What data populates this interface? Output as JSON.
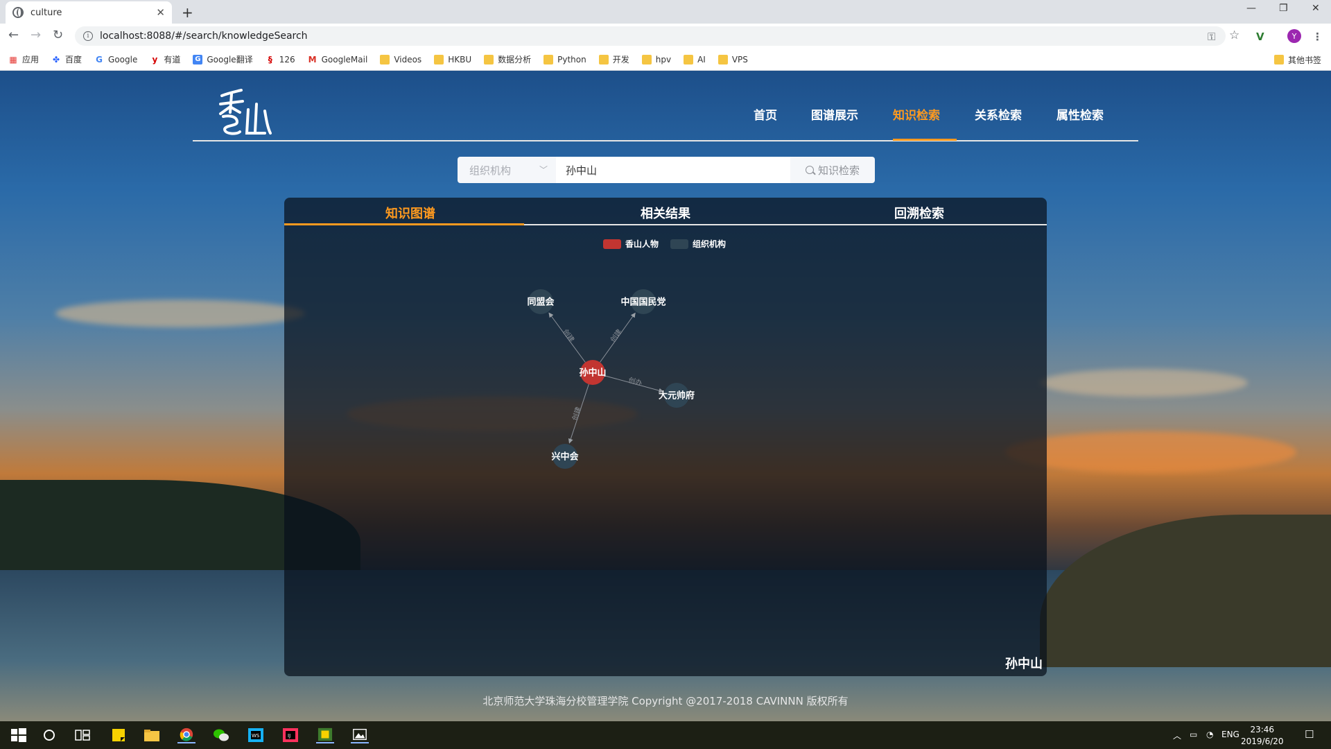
{
  "browser": {
    "tab_title": "culture",
    "url": "localhost:8088/#/search/knowledgeSearch",
    "bookmarks": [
      "应用",
      "百度",
      "Google",
      "有道",
      "Google翻译",
      "126",
      "GoogleMail",
      "Videos",
      "HKBU",
      "数据分析",
      "Python",
      "开发",
      "hpv",
      "AI",
      "VPS"
    ],
    "other_bookmarks": "其他书签",
    "avatar_letter": "Y"
  },
  "site": {
    "nav": [
      "首页",
      "图谱展示",
      "知识检索",
      "关系检索",
      "属性检索"
    ],
    "active_nav": "知识检索"
  },
  "search": {
    "category": "组织机构",
    "query": "孙中山",
    "button": "知识检索"
  },
  "panel": {
    "tabs": [
      "知识图谱",
      "相关结果",
      "回溯检索"
    ],
    "active_tab": "知识图谱",
    "legend": [
      {
        "label": "香山人物",
        "color": "#c23531"
      },
      {
        "label": "组织机构",
        "color": "#2f4554"
      }
    ],
    "corner_name": "孙中山"
  },
  "graph": {
    "nodes": [
      {
        "id": "孙中山",
        "category": "香山人物"
      },
      {
        "id": "同盟会",
        "category": "组织机构"
      },
      {
        "id": "中国国民党",
        "category": "组织机构"
      },
      {
        "id": "大元帅府",
        "category": "组织机构"
      },
      {
        "id": "兴中会",
        "category": "组织机构"
      }
    ],
    "edges": [
      {
        "source": "孙中山",
        "target": "同盟会",
        "label": "创建"
      },
      {
        "source": "孙中山",
        "target": "中国国民党",
        "label": "创建"
      },
      {
        "source": "孙中山",
        "target": "大元帅府",
        "label": "创办"
      },
      {
        "source": "孙中山",
        "target": "兴中会",
        "label": "创建"
      }
    ]
  },
  "footer": "北京师范大学珠海分校管理学院 Copyright @2017-2018 CAVINNN 版权所有",
  "taskbar": {
    "language": "ENG",
    "time": "23:46",
    "date": "2019/6/20"
  }
}
